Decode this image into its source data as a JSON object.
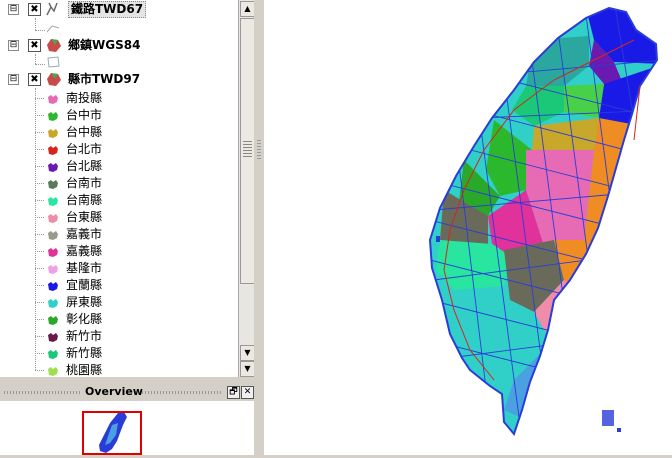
{
  "layers": [
    {
      "name": "鐵路TWD67",
      "expand": "⊟",
      "checked": "✖",
      "icon": "railway-line-icon"
    },
    {
      "name": "鄉鎮WGS84",
      "expand": "⊟",
      "checked": "✖",
      "icon": "polygon-layer-icon"
    },
    {
      "name": "縣市TWD97",
      "expand": "⊟",
      "checked": "✖",
      "icon": "polygon-layer-icon"
    }
  ],
  "classes": [
    {
      "label": "南投縣",
      "color": "#e66ab4"
    },
    {
      "label": "台中市",
      "color": "#2cb82c"
    },
    {
      "label": "台中縣",
      "color": "#c8a82a"
    },
    {
      "label": "台北市",
      "color": "#d4261c"
    },
    {
      "label": "台北縣",
      "color": "#6a1ab0"
    },
    {
      "label": "台南市",
      "color": "#5a7a5a"
    },
    {
      "label": "台南縣",
      "color": "#28e6a0"
    },
    {
      "label": "台東縣",
      "color": "#f08caa"
    },
    {
      "label": "嘉義市",
      "color": "#9a9a8a"
    },
    {
      "label": "嘉義縣",
      "color": "#e0329a"
    },
    {
      "label": "基隆市",
      "color": "#f0a0e6"
    },
    {
      "label": "宜蘭縣",
      "color": "#1a1ae6"
    },
    {
      "label": "屏東縣",
      "color": "#30d0c8"
    },
    {
      "label": "彰化縣",
      "color": "#2aa82a"
    },
    {
      "label": "新竹市",
      "color": "#6a1a4a"
    },
    {
      "label": "新竹縣",
      "color": "#1ac878"
    },
    {
      "label": "桃園縣",
      "color": "#a0e050"
    }
  ],
  "overview": {
    "title": "Overview",
    "float_button": "🗗",
    "close_button": "✕"
  },
  "scrollbar": {
    "up": "▲",
    "down": "▼"
  },
  "colors": {
    "boundary": "#2a3cd8",
    "overview_frame": "#e00000"
  }
}
